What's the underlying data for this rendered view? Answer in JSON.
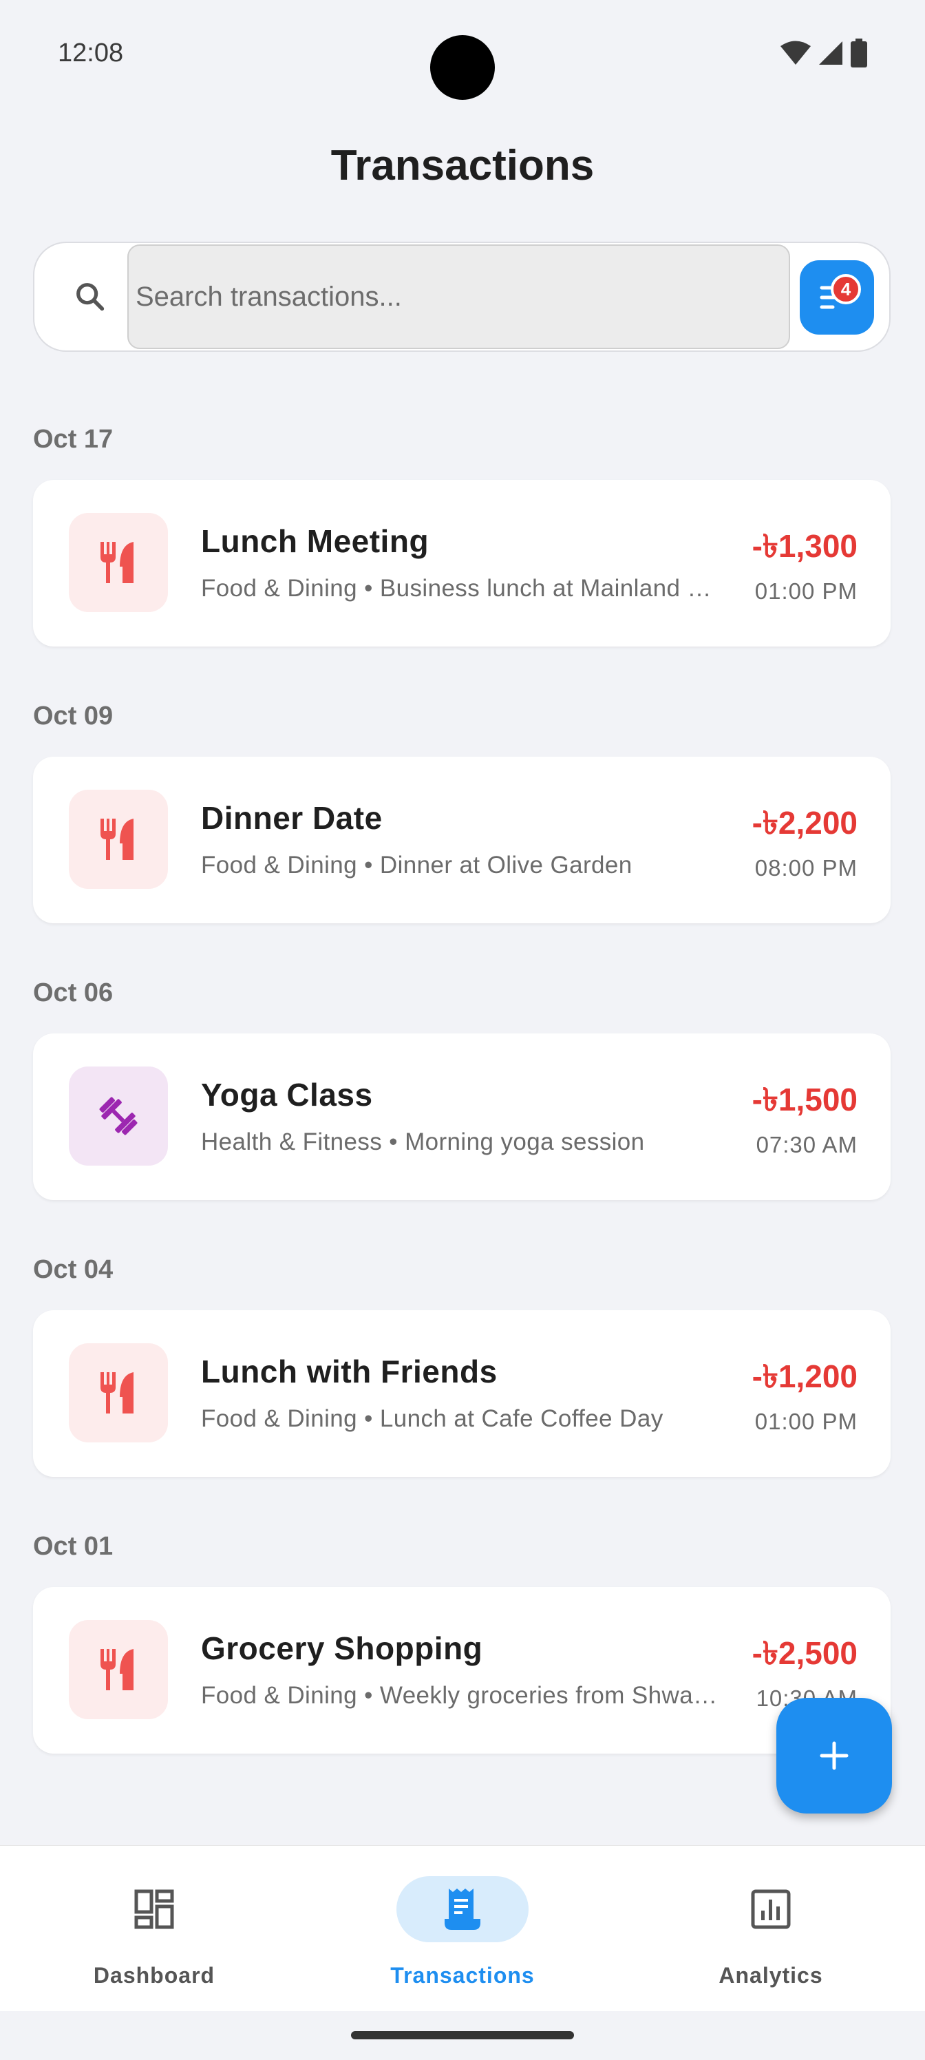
{
  "status": {
    "time": "12:08"
  },
  "header": {
    "title": "Transactions"
  },
  "search": {
    "placeholder": "Search transactions...",
    "value": "",
    "filter_badge": "4"
  },
  "colors": {
    "accent": "#1e8ef0",
    "expense": "#e53935",
    "food_bg": "#fdecec",
    "fitness_bg": "#f3e5f5"
  },
  "groups": [
    {
      "date": "Oct 17",
      "transactions": [
        {
          "title": "Lunch Meeting",
          "subtitle": "Food & Dining • Business lunch at Mainland China",
          "amount": "-৳1,300",
          "time": "01:00 PM",
          "icon": "fork-knife-icon"
        }
      ]
    },
    {
      "date": "Oct 09",
      "transactions": [
        {
          "title": "Dinner Date",
          "subtitle": "Food & Dining • Dinner at Olive Garden",
          "amount": "-৳2,200",
          "time": "08:00 PM",
          "icon": "fork-knife-icon"
        }
      ]
    },
    {
      "date": "Oct 06",
      "transactions": [
        {
          "title": "Yoga Class",
          "subtitle": "Health & Fitness • Morning yoga session",
          "amount": "-৳1,500",
          "time": "07:30 AM",
          "icon": "dumbbell-icon"
        }
      ]
    },
    {
      "date": "Oct 04",
      "transactions": [
        {
          "title": "Lunch with Friends",
          "subtitle": "Food & Dining • Lunch at Cafe Coffee Day",
          "amount": "-৳1,200",
          "time": "01:00 PM",
          "icon": "fork-knife-icon"
        }
      ]
    },
    {
      "date": "Oct 01",
      "transactions": [
        {
          "title": "Grocery Shopping",
          "subtitle": "Food & Dining • Weekly groceries from Shwapno",
          "amount": "-৳2,500",
          "time": "10:30 AM",
          "icon": "fork-knife-icon"
        }
      ]
    }
  ],
  "nav": {
    "items": [
      {
        "label": "Dashboard",
        "icon": "dashboard-icon",
        "active": false
      },
      {
        "label": "Transactions",
        "icon": "receipt-icon",
        "active": true
      },
      {
        "label": "Analytics",
        "icon": "analytics-icon",
        "active": false
      }
    ]
  }
}
